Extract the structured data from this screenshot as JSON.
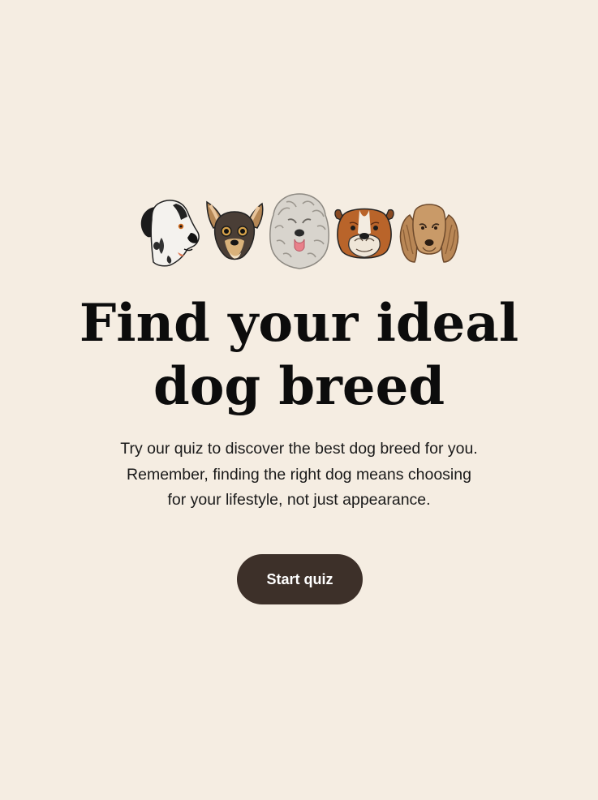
{
  "hero": {
    "dogs": [
      {
        "icon": "great-dane-icon"
      },
      {
        "icon": "chihuahua-icon"
      },
      {
        "icon": "old-english-sheepdog-icon"
      },
      {
        "icon": "bulldog-icon"
      },
      {
        "icon": "cocker-spaniel-icon"
      }
    ],
    "title_line1": "Find your ideal",
    "title_line2": "dog breed",
    "subtitle_line1": "Try our quiz to discover the best dog breed for you.",
    "subtitle_line2": "Remember, finding the right dog means choosing",
    "subtitle_line3": "for your lifestyle, not just appearance.",
    "cta_label": "Start quiz"
  },
  "colors": {
    "background": "#f5ede2",
    "button": "#3d3029",
    "button_text": "#ffffff",
    "title": "#0c0c0c"
  }
}
